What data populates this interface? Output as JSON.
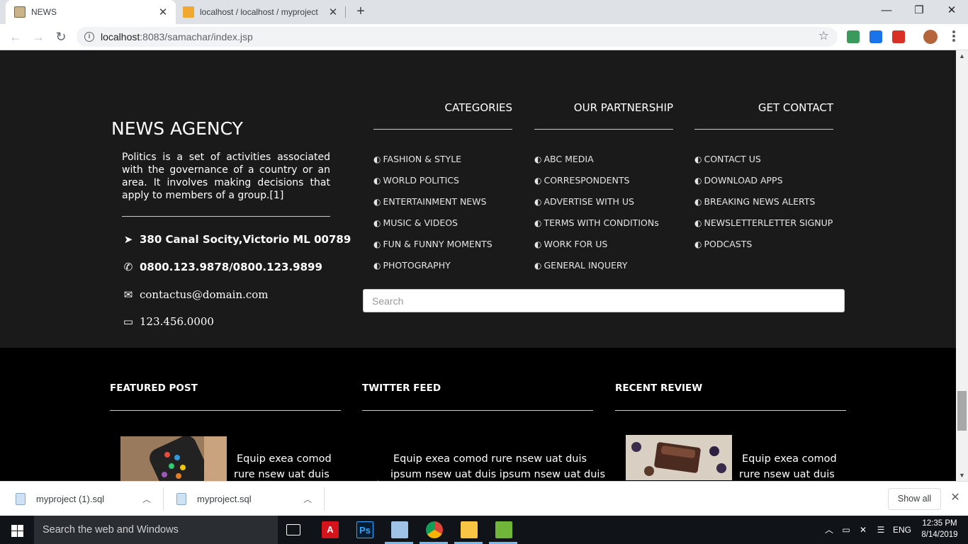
{
  "browser": {
    "tabs": [
      {
        "title": "NEWS",
        "active": true
      },
      {
        "title": "localhost / localhost / myproject",
        "active": false
      }
    ],
    "url_host": "localhost",
    "url_rest": ":8083/samachar/index.jsp",
    "window_controls": {
      "minimize": "—",
      "restore": "❐",
      "close": "✕"
    }
  },
  "agency": {
    "title": "NEWS AGENCY",
    "description": "Politics is a set of activities associated with the governance of a country or an area. It involves making decisions that apply to members of a group.[1]",
    "address": "380 Canal Socity,Victorio ML 00789",
    "phone": "0800.123.9878/0800.123.9899",
    "email": "contactus@domain.com",
    "fax": "123.456.0000"
  },
  "columns": {
    "categories": {
      "heading": "CATEGORIES",
      "items": [
        "FASHION & STYLE",
        "WORLD POLITICS",
        "ENTERTAINMENT NEWS",
        "MUSIC & VIDEOS",
        "FUN & FUNNY MOMENTS",
        "PHOTOGRAPHY"
      ]
    },
    "partnership": {
      "heading": "OUR PARTNERSHIP",
      "items": [
        "ABC MEDIA",
        "CORRESPONDENTS",
        "ADVERTISE WITH US",
        "TERMS WITH CONDITIONs",
        "WORK FOR US",
        "GENERAL INQUERY"
      ]
    },
    "contact": {
      "heading": "GET CONTACT",
      "items": [
        "CONTACT US",
        "DOWNLOAD APPS",
        "BREAKING NEWS ALERTS",
        "NEWSLETTERLETTER SIGNUP",
        "PODCASTS"
      ]
    }
  },
  "search": {
    "placeholder": "Search"
  },
  "sections": {
    "featured": {
      "heading": "FEATURED POST",
      "text_line1": "Equip exea comod",
      "text_line2": "rure  nsew uat duis"
    },
    "twitter": {
      "heading": "TWITTER FEED",
      "text_line1": "Equip exea comod rure  nsew uat duis",
      "text_line2": "ipsum nsew uat duis ipsum nsew uat duis"
    },
    "review": {
      "heading": "RECENT REVIEW",
      "text_line1": "Equip exea comod",
      "text_line2": "rure  nsew uat duis"
    }
  },
  "downloads": {
    "files": [
      "myproject (1).sql",
      "myproject.sql"
    ],
    "show_all": "Show all"
  },
  "taskbar": {
    "search_placeholder": "Search the web and Windows",
    "language": "ENG",
    "time": "12:35 PM",
    "date": "8/14/2019"
  },
  "colors": {
    "footer_upper": "#1a1a1a",
    "footer_lower": "#000000",
    "taskbar": "#101418"
  }
}
